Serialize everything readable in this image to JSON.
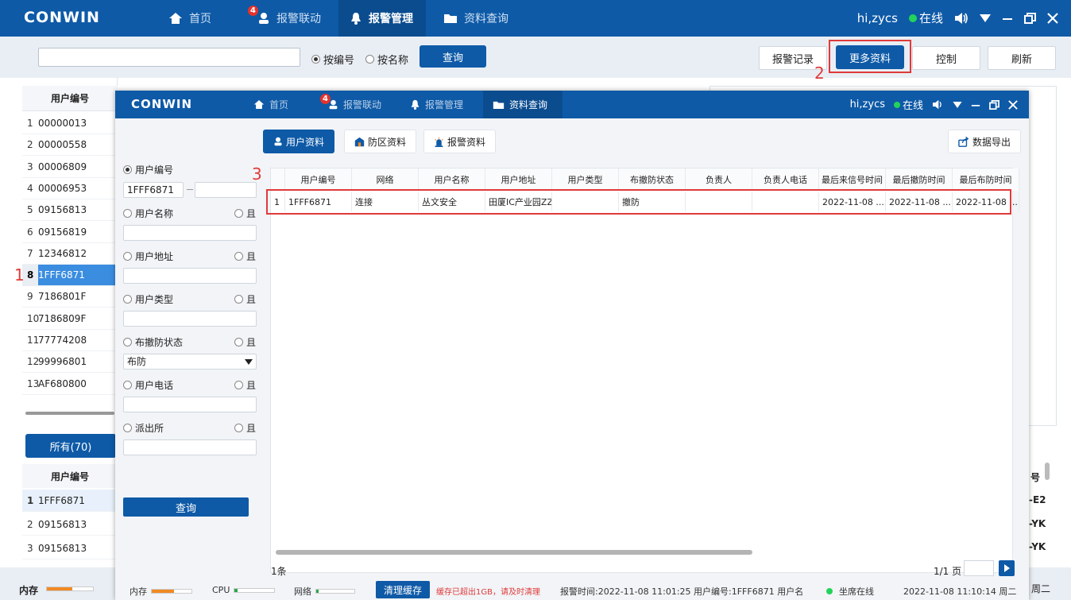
{
  "bg": {
    "logo": "CONWIN",
    "nav": [
      {
        "label": "首页",
        "icon": "home-icon"
      },
      {
        "label": "报警联动",
        "icon": "user-icon",
        "badge": "4"
      },
      {
        "label": "报警管理",
        "icon": "bell-icon"
      },
      {
        "label": "资料查询",
        "icon": "folder-icon"
      }
    ],
    "user": "hi,zycs",
    "online": "在线",
    "search": {
      "placeholder": "",
      "radio_code": "按编号",
      "radio_name": "按名称",
      "query": "查询"
    },
    "actions": {
      "records": "报警记录",
      "more": "更多资料",
      "control": "控制",
      "refresh": "刷新"
    },
    "marker1": "1",
    "marker2": "2",
    "marker3": "3",
    "left_header": "用户编号",
    "left_rows": [
      {
        "n": "1",
        "code": "00000013"
      },
      {
        "n": "2",
        "code": "00000558"
      },
      {
        "n": "3",
        "code": "00006809"
      },
      {
        "n": "4",
        "code": "00006953"
      },
      {
        "n": "5",
        "code": "09156813"
      },
      {
        "n": "6",
        "code": "09156819"
      },
      {
        "n": "7",
        "code": "12346812"
      },
      {
        "n": "8",
        "code": "1FFF6871"
      },
      {
        "n": "9",
        "code": "7186801F"
      },
      {
        "n": "10",
        "code": "7186809F"
      },
      {
        "n": "11",
        "code": "77774208"
      },
      {
        "n": "12",
        "code": "99996801"
      },
      {
        "n": "13",
        "code": "AF680800"
      }
    ],
    "all_button": "所有(70)",
    "lower_header": "用户编号",
    "lower_rows": [
      {
        "n": "1",
        "code": "1FFF6871"
      },
      {
        "n": "2",
        "code": "09156813"
      },
      {
        "n": "3",
        "code": "09156813"
      }
    ],
    "right_partial": [
      "号",
      "-E2",
      "-YK",
      "-YK"
    ],
    "memory_label": "内存",
    "weekday_partial": "周二"
  },
  "fw": {
    "logo": "CONWIN",
    "nav": [
      {
        "label": "首页"
      },
      {
        "label": "报警联动",
        "badge": "4"
      },
      {
        "label": "报警管理"
      },
      {
        "label": "资料查询"
      }
    ],
    "user": "hi,zycs",
    "online": "在线",
    "tabs": {
      "user": "用户资料",
      "zone": "防区资料",
      "alarm": "报警资料",
      "export": "数据导出"
    },
    "filters": {
      "code": "用户编号",
      "code_value": "1FFF6871",
      "name": "用户名称",
      "address": "用户地址",
      "type": "用户类型",
      "arm": "布撤防状态",
      "arm_value": "布防",
      "phone": "用户电话",
      "police": "派出所",
      "and": "且",
      "query": "查询"
    },
    "columns": [
      "用户编号",
      "网络",
      "用户名称",
      "用户地址",
      "用户类型",
      "布撤防状态",
      "负责人",
      "负责人电话",
      "最后来信号时间",
      "最后撤防时间",
      "最后布防时间"
    ],
    "row": {
      "n": "1",
      "cells": [
        "1FFF6871",
        "连接",
        "丛文安全",
        "田厦IC产业园ZZZ",
        "",
        "撤防",
        "",
        "",
        "2022-11-08 ...",
        "2022-11-08 ...",
        "2022-11-08 ..."
      ]
    },
    "count": "1条",
    "page": "1/1 页",
    "status": {
      "mem": "内存",
      "cpu": "CPU",
      "net": "网络",
      "clear": "清理缓存",
      "warn": "缓存已超出1GB，请及时清理",
      "alarm_info": "报警时间:2022-11-08 11:01:25  用户编号:1FFF6871  用户名",
      "seat": "坐席在线",
      "clock": "2022-11-08 11:10:14 周二"
    }
  },
  "colors": {
    "brand": "#0e5aa7",
    "marker": "#e03a3a",
    "online": "#22d35a",
    "mem": "#f08a24",
    "cpu": "#2aa84a"
  }
}
